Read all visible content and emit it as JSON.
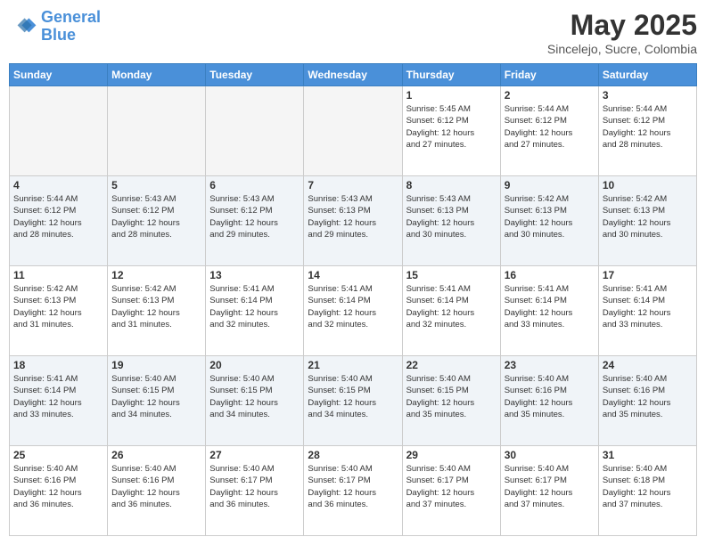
{
  "header": {
    "logo_line1": "General",
    "logo_line2": "Blue",
    "month_title": "May 2025",
    "location": "Sincelejo, Sucre, Colombia"
  },
  "weekdays": [
    "Sunday",
    "Monday",
    "Tuesday",
    "Wednesday",
    "Thursday",
    "Friday",
    "Saturday"
  ],
  "weeks": [
    [
      {
        "day": "",
        "info": ""
      },
      {
        "day": "",
        "info": ""
      },
      {
        "day": "",
        "info": ""
      },
      {
        "day": "",
        "info": ""
      },
      {
        "day": "1",
        "info": "Sunrise: 5:45 AM\nSunset: 6:12 PM\nDaylight: 12 hours\nand 27 minutes."
      },
      {
        "day": "2",
        "info": "Sunrise: 5:44 AM\nSunset: 6:12 PM\nDaylight: 12 hours\nand 27 minutes."
      },
      {
        "day": "3",
        "info": "Sunrise: 5:44 AM\nSunset: 6:12 PM\nDaylight: 12 hours\nand 28 minutes."
      }
    ],
    [
      {
        "day": "4",
        "info": "Sunrise: 5:44 AM\nSunset: 6:12 PM\nDaylight: 12 hours\nand 28 minutes."
      },
      {
        "day": "5",
        "info": "Sunrise: 5:43 AM\nSunset: 6:12 PM\nDaylight: 12 hours\nand 28 minutes."
      },
      {
        "day": "6",
        "info": "Sunrise: 5:43 AM\nSunset: 6:12 PM\nDaylight: 12 hours\nand 29 minutes."
      },
      {
        "day": "7",
        "info": "Sunrise: 5:43 AM\nSunset: 6:13 PM\nDaylight: 12 hours\nand 29 minutes."
      },
      {
        "day": "8",
        "info": "Sunrise: 5:43 AM\nSunset: 6:13 PM\nDaylight: 12 hours\nand 30 minutes."
      },
      {
        "day": "9",
        "info": "Sunrise: 5:42 AM\nSunset: 6:13 PM\nDaylight: 12 hours\nand 30 minutes."
      },
      {
        "day": "10",
        "info": "Sunrise: 5:42 AM\nSunset: 6:13 PM\nDaylight: 12 hours\nand 30 minutes."
      }
    ],
    [
      {
        "day": "11",
        "info": "Sunrise: 5:42 AM\nSunset: 6:13 PM\nDaylight: 12 hours\nand 31 minutes."
      },
      {
        "day": "12",
        "info": "Sunrise: 5:42 AM\nSunset: 6:13 PM\nDaylight: 12 hours\nand 31 minutes."
      },
      {
        "day": "13",
        "info": "Sunrise: 5:41 AM\nSunset: 6:14 PM\nDaylight: 12 hours\nand 32 minutes."
      },
      {
        "day": "14",
        "info": "Sunrise: 5:41 AM\nSunset: 6:14 PM\nDaylight: 12 hours\nand 32 minutes."
      },
      {
        "day": "15",
        "info": "Sunrise: 5:41 AM\nSunset: 6:14 PM\nDaylight: 12 hours\nand 32 minutes."
      },
      {
        "day": "16",
        "info": "Sunrise: 5:41 AM\nSunset: 6:14 PM\nDaylight: 12 hours\nand 33 minutes."
      },
      {
        "day": "17",
        "info": "Sunrise: 5:41 AM\nSunset: 6:14 PM\nDaylight: 12 hours\nand 33 minutes."
      }
    ],
    [
      {
        "day": "18",
        "info": "Sunrise: 5:41 AM\nSunset: 6:14 PM\nDaylight: 12 hours\nand 33 minutes."
      },
      {
        "day": "19",
        "info": "Sunrise: 5:40 AM\nSunset: 6:15 PM\nDaylight: 12 hours\nand 34 minutes."
      },
      {
        "day": "20",
        "info": "Sunrise: 5:40 AM\nSunset: 6:15 PM\nDaylight: 12 hours\nand 34 minutes."
      },
      {
        "day": "21",
        "info": "Sunrise: 5:40 AM\nSunset: 6:15 PM\nDaylight: 12 hours\nand 34 minutes."
      },
      {
        "day": "22",
        "info": "Sunrise: 5:40 AM\nSunset: 6:15 PM\nDaylight: 12 hours\nand 35 minutes."
      },
      {
        "day": "23",
        "info": "Sunrise: 5:40 AM\nSunset: 6:16 PM\nDaylight: 12 hours\nand 35 minutes."
      },
      {
        "day": "24",
        "info": "Sunrise: 5:40 AM\nSunset: 6:16 PM\nDaylight: 12 hours\nand 35 minutes."
      }
    ],
    [
      {
        "day": "25",
        "info": "Sunrise: 5:40 AM\nSunset: 6:16 PM\nDaylight: 12 hours\nand 36 minutes."
      },
      {
        "day": "26",
        "info": "Sunrise: 5:40 AM\nSunset: 6:16 PM\nDaylight: 12 hours\nand 36 minutes."
      },
      {
        "day": "27",
        "info": "Sunrise: 5:40 AM\nSunset: 6:17 PM\nDaylight: 12 hours\nand 36 minutes."
      },
      {
        "day": "28",
        "info": "Sunrise: 5:40 AM\nSunset: 6:17 PM\nDaylight: 12 hours\nand 36 minutes."
      },
      {
        "day": "29",
        "info": "Sunrise: 5:40 AM\nSunset: 6:17 PM\nDaylight: 12 hours\nand 37 minutes."
      },
      {
        "day": "30",
        "info": "Sunrise: 5:40 AM\nSunset: 6:17 PM\nDaylight: 12 hours\nand 37 minutes."
      },
      {
        "day": "31",
        "info": "Sunrise: 5:40 AM\nSunset: 6:18 PM\nDaylight: 12 hours\nand 37 minutes."
      }
    ]
  ]
}
